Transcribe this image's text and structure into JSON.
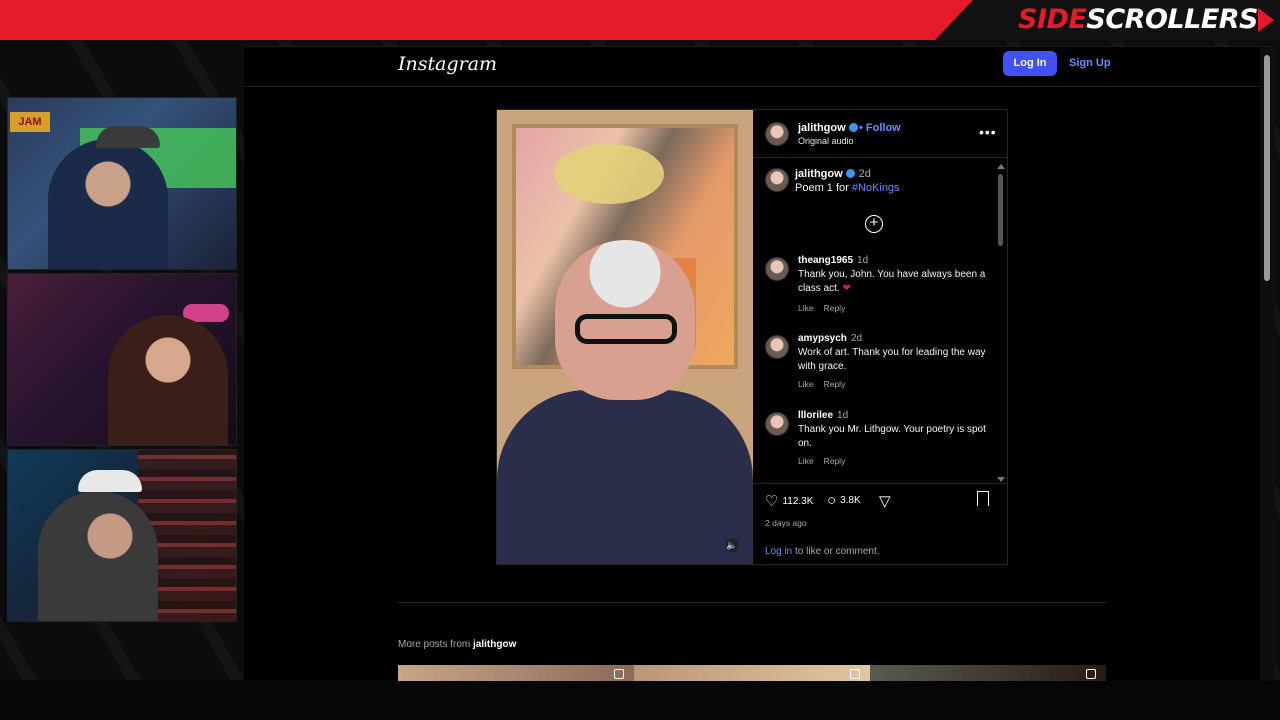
{
  "overlay": {
    "brand_side": "SIDE",
    "brand_scrollers": "SCROLLERS",
    "cam1_sign": "JAM"
  },
  "instagram": {
    "logo": "Instagram",
    "login_button": "Log In",
    "signup_button": "Sign Up",
    "post": {
      "author": "jalithgow",
      "follow": "• Follow",
      "audio": "Original audio",
      "caption_user": "jalithgow",
      "caption_time": "2d",
      "caption_prefix": "Poem 1 for ",
      "caption_hashtag": "#NoKings",
      "comments": [
        {
          "user": "theang1965",
          "time": "1d",
          "text": "Thank you, John. You have always been a class act.",
          "emoji": "❤",
          "like": "Like",
          "reply": "Reply"
        },
        {
          "user": "amypsych",
          "time": "2d",
          "text": "Work of art. Thank you for leading the way with grace.",
          "like": "Like",
          "reply": "Reply"
        },
        {
          "user": "lllorilee",
          "time": "1d",
          "text": "Thank you Mr. Lithgow. Your poetry is spot on.",
          "like": "Like",
          "reply": "Reply"
        }
      ],
      "likes": "112.3K",
      "comment_count": "3.8K",
      "age": "2 days ago",
      "login_link": "Log in",
      "login_suffix": " to like or comment."
    },
    "more_posts_prefix": "More posts from ",
    "more_posts_user": "jalithgow"
  }
}
